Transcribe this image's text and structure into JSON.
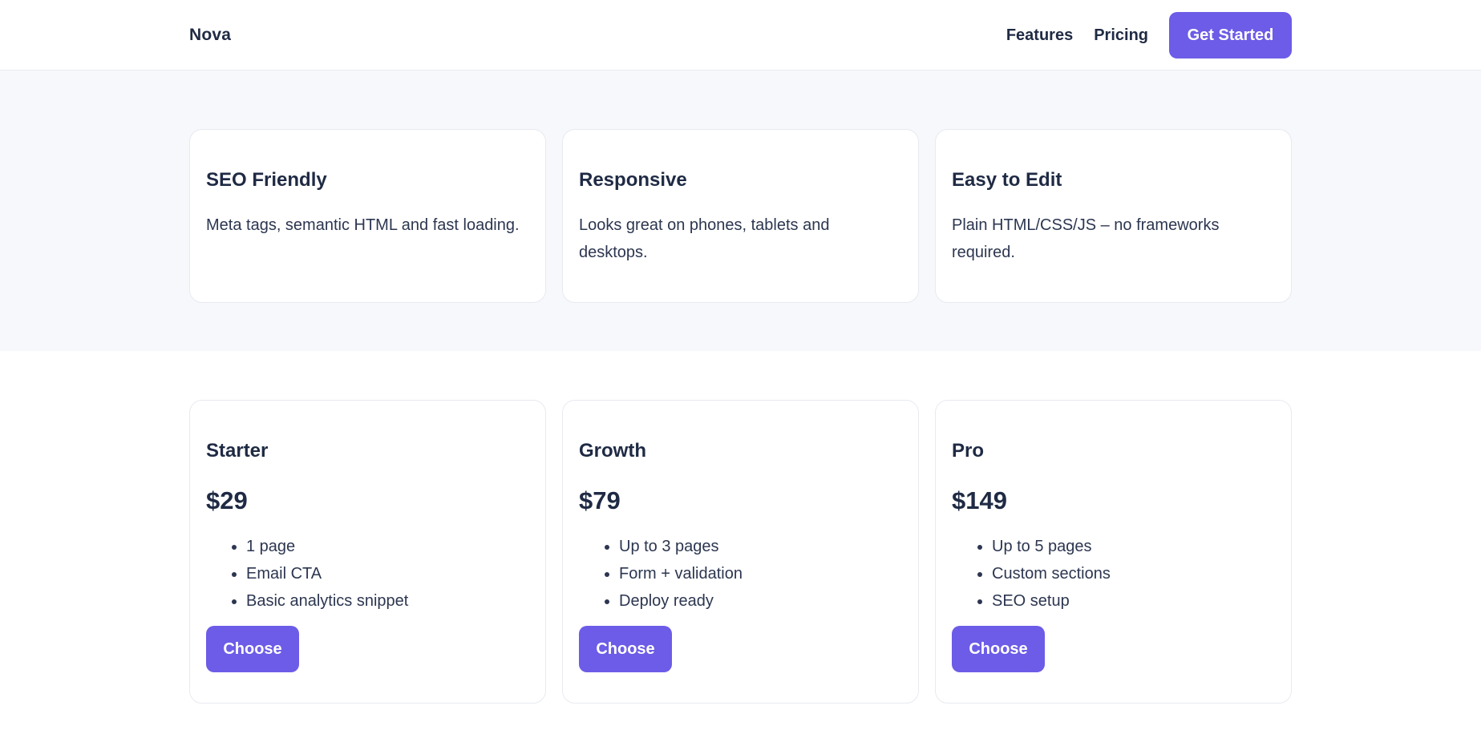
{
  "header": {
    "logo": "Nova",
    "nav": [
      {
        "label": "Features"
      },
      {
        "label": "Pricing"
      }
    ],
    "cta_label": "Get Started"
  },
  "features": [
    {
      "title": "SEO Friendly",
      "description": "Meta tags, semantic HTML and fast loading."
    },
    {
      "title": "Responsive",
      "description": "Looks great on phones, tablets and desktops."
    },
    {
      "title": "Easy to Edit",
      "description": "Plain HTML/CSS/JS – no frameworks required."
    }
  ],
  "pricing": [
    {
      "name": "Starter",
      "price": "$29",
      "features": [
        "1 page",
        "Email CTA",
        "Basic analytics snippet"
      ],
      "button": "Choose"
    },
    {
      "name": "Growth",
      "price": "$79",
      "features": [
        "Up to 3 pages",
        "Form + validation",
        "Deploy ready"
      ],
      "button": "Choose"
    },
    {
      "name": "Pro",
      "price": "$149",
      "features": [
        "Up to 5 pages",
        "Custom sections",
        "SEO setup"
      ],
      "button": "Choose"
    }
  ],
  "colors": {
    "accent": "#6c5ce7",
    "text": "#1f2a44",
    "section_bg": "#f7f8fb",
    "border": "#e8eaf0"
  }
}
